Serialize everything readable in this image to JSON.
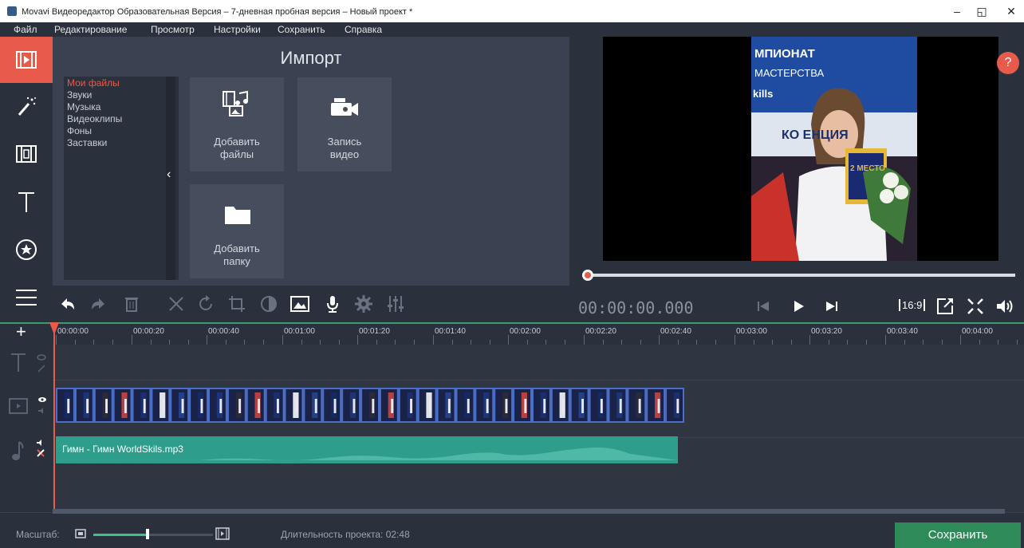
{
  "window": {
    "title": "Movavi Видеоредактор Образовательная Версия – 7-дневная пробная версия – Новый проект *",
    "minimize": "–",
    "maximize": "◱",
    "close": "✕"
  },
  "menu": [
    "Файл",
    "Редактирование",
    "Просмотр",
    "Настройки",
    "Сохранить",
    "Справка"
  ],
  "left_toolbar": [
    {
      "name": "import-icon",
      "active": true
    },
    {
      "name": "magic-wand-icon",
      "active": false
    },
    {
      "name": "transitions-icon",
      "active": false
    },
    {
      "name": "titles-icon",
      "active": false
    },
    {
      "name": "stickers-icon",
      "active": false
    },
    {
      "name": "more-icon",
      "active": false
    }
  ],
  "import": {
    "title": "Импорт",
    "categories": [
      "Мои файлы",
      "Звуки",
      "Музыка",
      "Видеоклипы",
      "Фоны",
      "Заставки"
    ],
    "selected_category": "Мои файлы",
    "collapse_arrow": "‹",
    "tiles": {
      "add_files": {
        "line1": "Добавить",
        "line2": "файлы"
      },
      "record_video": {
        "line1": "Запись",
        "line2": "видео"
      },
      "add_folder": {
        "line1": "Добавить",
        "line2": "папку"
      }
    }
  },
  "preview": {
    "help": "?",
    "photo_text_1": "МПИОНАТ",
    "photo_text_2": "МАСТЕРСТВА",
    "photo_text_3": "kills",
    "photo_text_4": "КО   ЕНЦИЯ",
    "photo_text_5": "2 МЕСТО",
    "seek_progress": 0
  },
  "playback": {
    "timecode": "00:00:00.000",
    "aspect": "16:9"
  },
  "timeline": {
    "ticks": [
      "00:00:00",
      "00:00:20",
      "00:00:40",
      "00:01:00",
      "00:01:20",
      "00:01:40",
      "00:02:00",
      "00:02:20",
      "00:02:40",
      "00:03:00",
      "00:03:20",
      "00:03:40",
      "00:04:00"
    ],
    "add": "+",
    "video_frames": 33,
    "audio_clip_name": "Гимн - Гимн  WorldSkils.mp3"
  },
  "status": {
    "zoom_label": "Масштаб:",
    "zoom_level": 0.45,
    "duration_label": "Длительность проекта: 02:48",
    "save_button": "Сохранить"
  },
  "colors": {
    "accent": "#e85a4a",
    "save": "#2e8a58",
    "audio": "#2e9d8c",
    "clip_border": "#4a6fc9"
  }
}
